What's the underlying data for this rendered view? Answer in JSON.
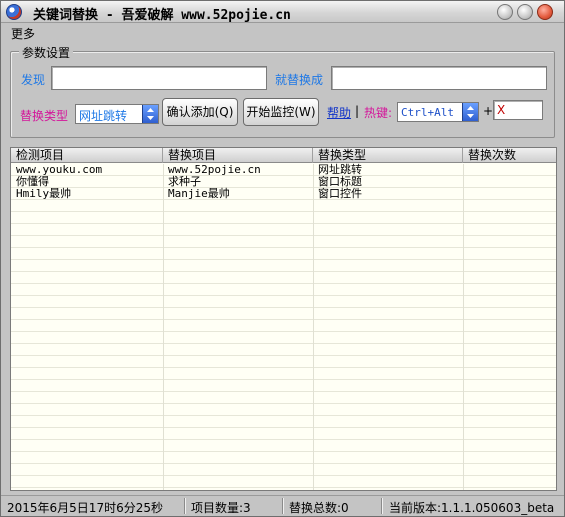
{
  "window": {
    "title": "关键词替换 - 吾爱破解 www.52pojie.cn",
    "colors": {
      "accent_blue": "#1e78e6",
      "accent_magenta": "#d4159a",
      "hotkey_value": "#c00000",
      "link": "#1234c8"
    }
  },
  "menu": {
    "items": [
      "更多"
    ]
  },
  "settings": {
    "group_title": "参数设置",
    "find_label": "发现",
    "find_value": "",
    "replace_label": "就替换成",
    "replace_value": "",
    "type_label": "替换类型",
    "type_selected": "网址跳转",
    "confirm_add_button": "确认添加(Q)",
    "start_monitor_button": "开始监控(W)",
    "help_link": "帮助",
    "separator": "|",
    "hotkey_label": "热键:",
    "hotkey_modifier": "Ctrl+Alt",
    "hotkey_plus": "+",
    "hotkey_key": "X"
  },
  "table": {
    "columns": [
      "检测项目",
      "替换项目",
      "替换类型",
      "替换次数"
    ],
    "rows": [
      [
        "www.youku.com",
        "www.52pojie.cn",
        "网址跳转",
        ""
      ],
      [
        "你懂得",
        "求种子",
        "窗口标题",
        ""
      ],
      [
        "Hmily最帅",
        "Manjie最帅",
        "窗口控件",
        ""
      ]
    ]
  },
  "status": {
    "datetime": "2015年6月5日17时6分25秒",
    "item_count": "项目数量:3",
    "replace_total": "替换总数:0",
    "version": "当前版本:1.1.1.050603_beta"
  }
}
